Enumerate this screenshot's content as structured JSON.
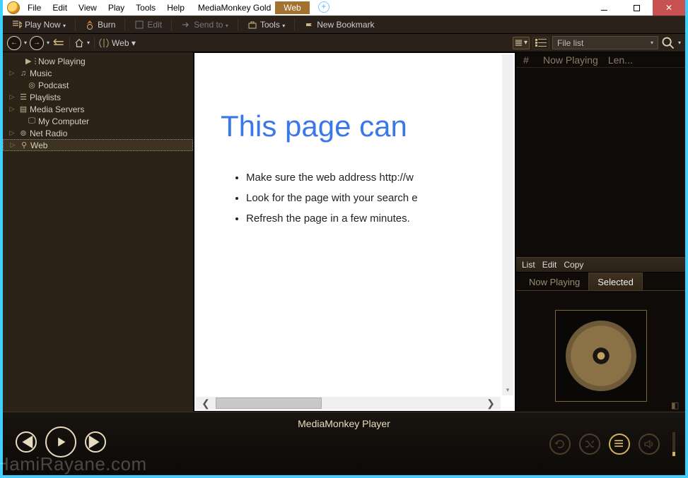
{
  "title": {
    "app": "MediaMonkey Gold",
    "tab": "Web"
  },
  "menu": [
    "File",
    "Edit",
    "View",
    "Play",
    "Tools",
    "Help"
  ],
  "toolbar": {
    "play_now": "Play Now",
    "burn": "Burn",
    "edit": "Edit",
    "send_to": "Send to",
    "tools": "Tools",
    "new_bookmark": "New Bookmark"
  },
  "nav": {
    "breadcrumb_item": "Web",
    "filelist_combo": "File list"
  },
  "tree": [
    {
      "label": "Now Playing",
      "icon": "now-playing-icon",
      "expandable": false
    },
    {
      "label": "Music",
      "icon": "music-icon",
      "expandable": true
    },
    {
      "label": "Podcast",
      "icon": "podcast-icon",
      "expandable": false
    },
    {
      "label": "Playlists",
      "icon": "playlists-icon",
      "expandable": true
    },
    {
      "label": "Media Servers",
      "icon": "server-icon",
      "expandable": true
    },
    {
      "label": "My Computer",
      "icon": "computer-icon",
      "expandable": false
    },
    {
      "label": "Net Radio",
      "icon": "radio-icon",
      "expandable": true
    },
    {
      "label": "Web",
      "icon": "web-icon",
      "expandable": true,
      "selected": true
    }
  ],
  "webpage": {
    "heading": "This page can",
    "bullets": [
      "Make sure the web address http://w",
      "Look for the page with your search e",
      "Refresh the page in a few minutes."
    ]
  },
  "rightpane": {
    "columns": {
      "num": "#",
      "title": "Now Playing",
      "len": "Len..."
    },
    "menu": [
      "List",
      "Edit",
      "Copy"
    ],
    "tabs": {
      "now_playing": "Now Playing",
      "selected": "Selected"
    }
  },
  "player": {
    "title": "MediaMonkey Player"
  },
  "watermark": "HamiRayane.com"
}
